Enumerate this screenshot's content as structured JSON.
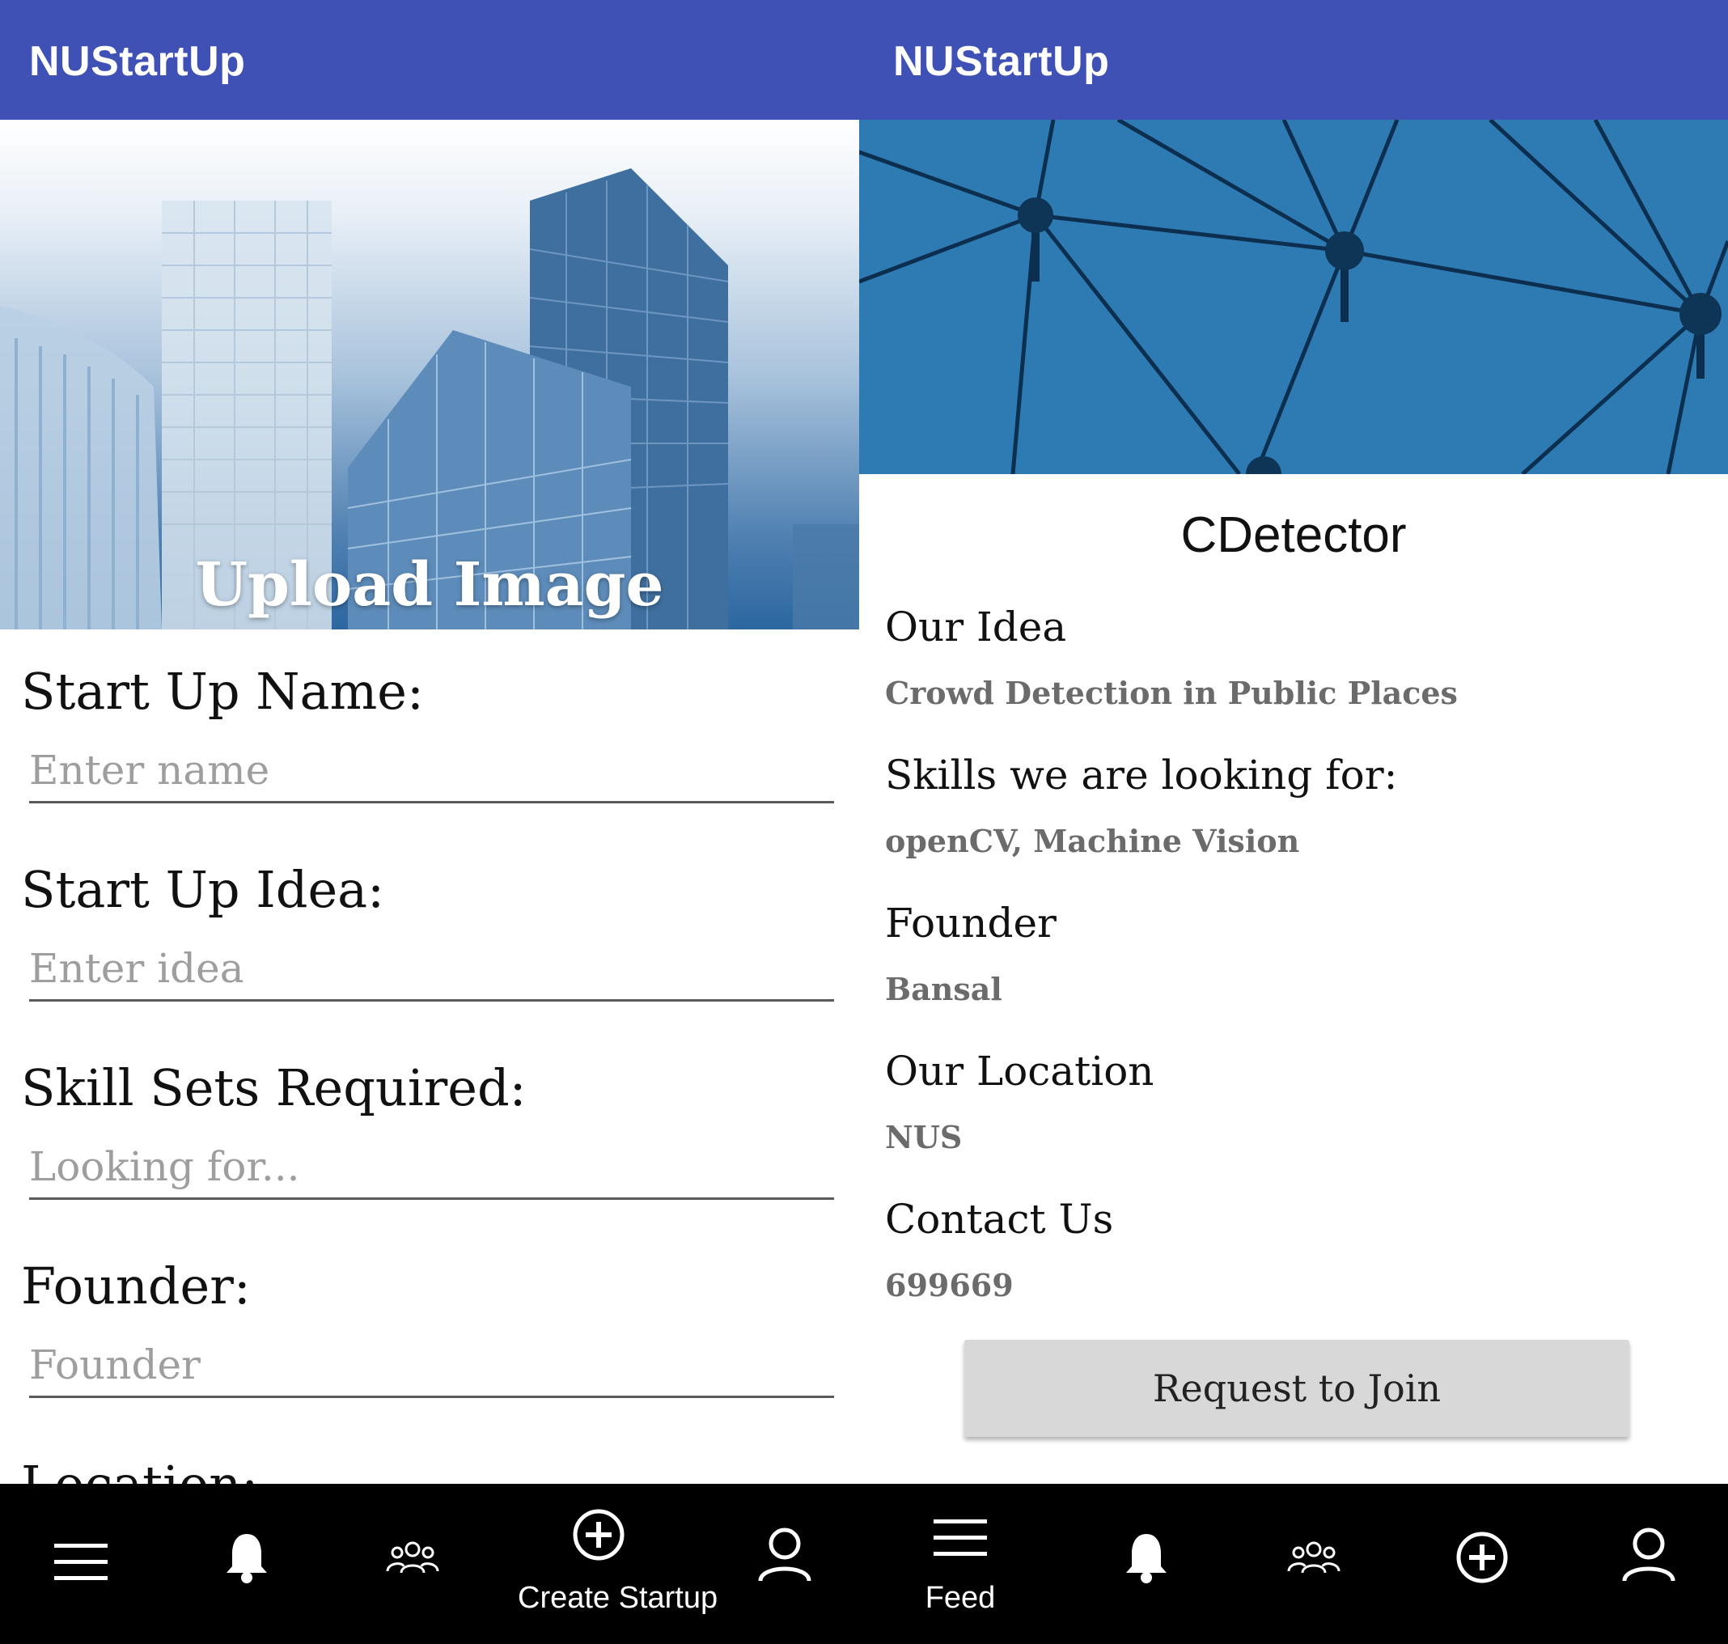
{
  "left_screen": {
    "app_title": "NUStartUp",
    "upload_label": "Upload Image",
    "fields": [
      {
        "label": "Start Up Name:",
        "placeholder": "Enter name"
      },
      {
        "label": "Start Up Idea:",
        "placeholder": "Enter idea"
      },
      {
        "label": "Skill Sets Required:",
        "placeholder": "Looking for..."
      },
      {
        "label": "Founder:",
        "placeholder": "Founder"
      },
      {
        "label": "Location:"
      }
    ],
    "bottom_nav": {
      "create_label": "Create Startup"
    }
  },
  "right_screen": {
    "app_title": "NUStartUp",
    "startup_name": "CDetector",
    "sections": [
      {
        "heading": "Our Idea",
        "value": "Crowd Detection in Public Places"
      },
      {
        "heading": "Skills we are looking for:",
        "value": "openCV, Machine Vision"
      },
      {
        "heading": "Founder",
        "value": "Bansal"
      },
      {
        "heading": "Our Location",
        "value": "NUS"
      },
      {
        "heading": "Contact Us",
        "value": "699669"
      }
    ],
    "join_button": "Request to Join",
    "bottom_nav": {
      "feed_label": "Feed"
    }
  },
  "colors": {
    "app_bar": "#3f51b5",
    "nav_bar": "#000000",
    "button_bg": "#d8d8d8",
    "value_text": "#6b6b6b"
  },
  "icons": [
    "menu-icon",
    "bell-icon",
    "group-icon",
    "add-circle-icon",
    "person-icon"
  ]
}
